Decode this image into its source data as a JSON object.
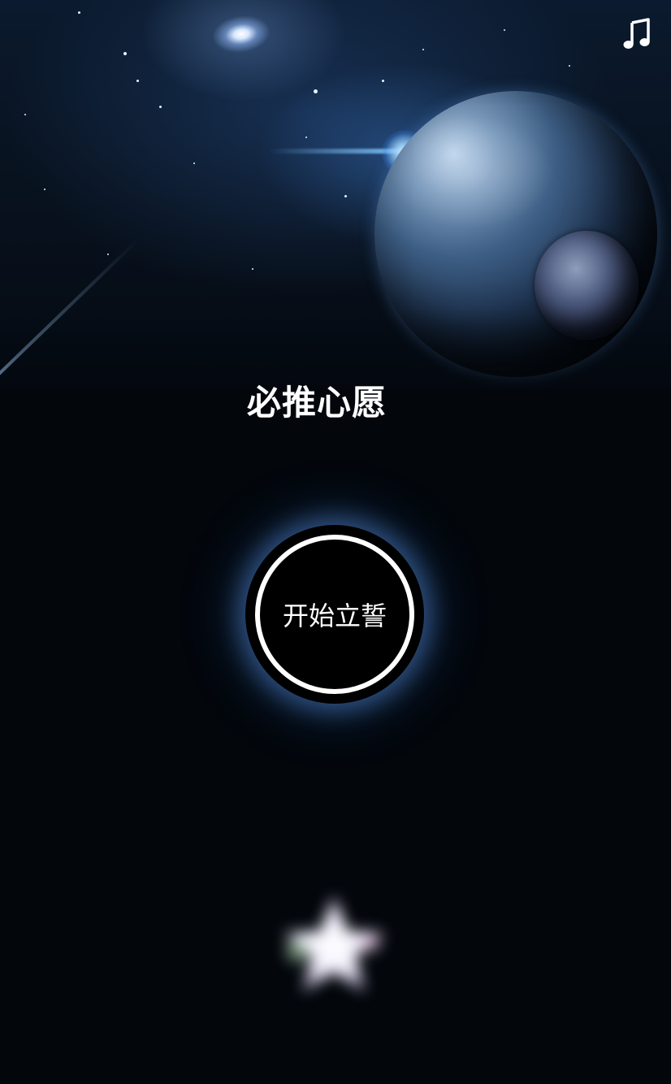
{
  "header": {
    "music_icon": "music-note-icon",
    "music_icon_glyph": "♫"
  },
  "main": {
    "title": "必推心愿",
    "start_button_label": "开始立誓"
  },
  "decor": {
    "bottom_icon": "glowing-star-icon"
  },
  "colors": {
    "background": "#03070c",
    "text": "#ffffff",
    "button_fill": "#000000",
    "button_glow": "#5a96e6"
  }
}
